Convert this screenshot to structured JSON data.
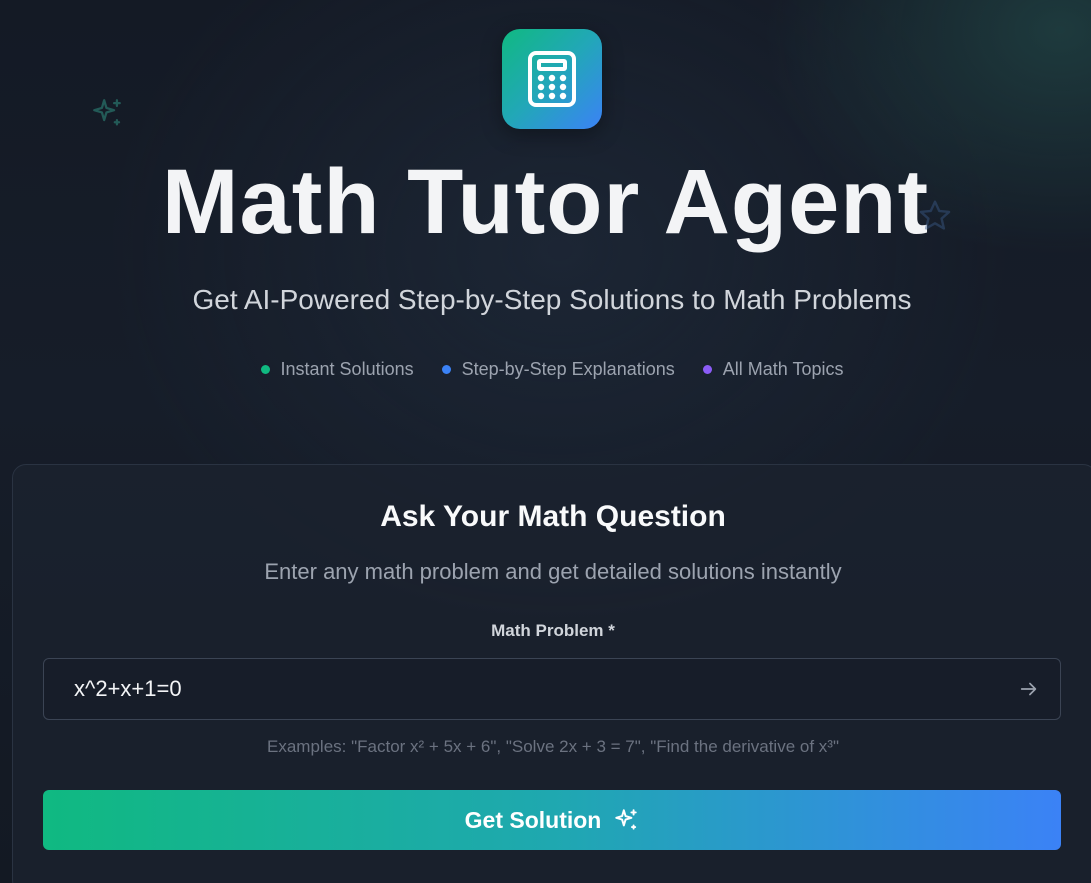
{
  "header": {
    "logo_icon": "calculator-icon",
    "title": "Math Tutor Agent",
    "subtitle": "Get AI-Powered Step-by-Step Solutions to Math Problems"
  },
  "features": [
    {
      "label": "Instant Solutions",
      "color": "#10b981"
    },
    {
      "label": "Step-by-Step Explanations",
      "color": "#3b82f6"
    },
    {
      "label": "All Math Topics",
      "color": "#8b5cf6"
    }
  ],
  "form": {
    "title": "Ask Your Math Question",
    "description": "Enter any math problem and get detailed solutions instantly",
    "field_label": "Math Problem *",
    "input_value": "x^2+x+1=0",
    "examples": "Examples: \"Factor x² + 5x + 6\", \"Solve 2x + 3 = 7\", \"Find the derivative of x³\"",
    "submit_label": "Get Solution",
    "submit_icon": "sparkles-icon"
  },
  "colors": {
    "accent_start": "#10b981",
    "accent_end": "#3b82f6",
    "background": "#141a25"
  }
}
